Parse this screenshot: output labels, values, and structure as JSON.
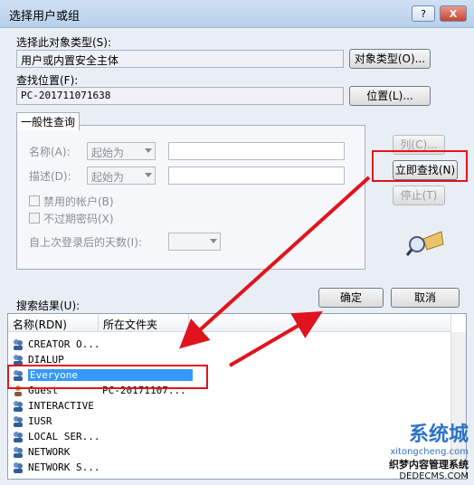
{
  "window": {
    "title": "选择用户或组",
    "help_btn": "?",
    "close_btn": "X"
  },
  "object_type": {
    "label": "选择此对象类型(S):",
    "value": "用户或内置安全主体",
    "button": "对象类型(O)..."
  },
  "location": {
    "label": "查找位置(F):",
    "value": "PC-201711071638",
    "button": "位置(L)..."
  },
  "common_query": {
    "tab": "一般性查询",
    "name_label": "名称(A):",
    "name_op": "起始为",
    "desc_label": "描述(D):",
    "desc_op": "起始为",
    "disabled_accounts": "禁用的帐户(B)",
    "no_expire_pwd": "不过期密码(X)",
    "days_label": "自上次登录后的天数(I):"
  },
  "side_buttons": {
    "columns": "列(C)...",
    "find_now": "立即查找(N)",
    "stop": "停止(T)"
  },
  "results_label": "搜索结果(U):",
  "ok": "确定",
  "cancel": "取消",
  "columns": [
    "名称(RDN)",
    "所在文件夹"
  ],
  "rows": [
    {
      "name": "CREATOR O...",
      "folder": ""
    },
    {
      "name": "DIALUP",
      "folder": ""
    },
    {
      "name": "Everyone",
      "folder": ""
    },
    {
      "name": "Guest",
      "folder": "PC-20171107..."
    },
    {
      "name": "INTERACTIVE",
      "folder": ""
    },
    {
      "name": "IUSR",
      "folder": ""
    },
    {
      "name": "LOCAL SER...",
      "folder": ""
    },
    {
      "name": "NETWORK",
      "folder": ""
    },
    {
      "name": "NETWORK S...",
      "folder": ""
    }
  ],
  "watermark": {
    "line1": "系统城",
    "line2": "xitongcheng.com",
    "line3": "织梦内容管理系统",
    "line4": "DEDECMS.COM"
  },
  "colors": {
    "highlight_red": "#e0141e",
    "selection": "#3399ff"
  }
}
